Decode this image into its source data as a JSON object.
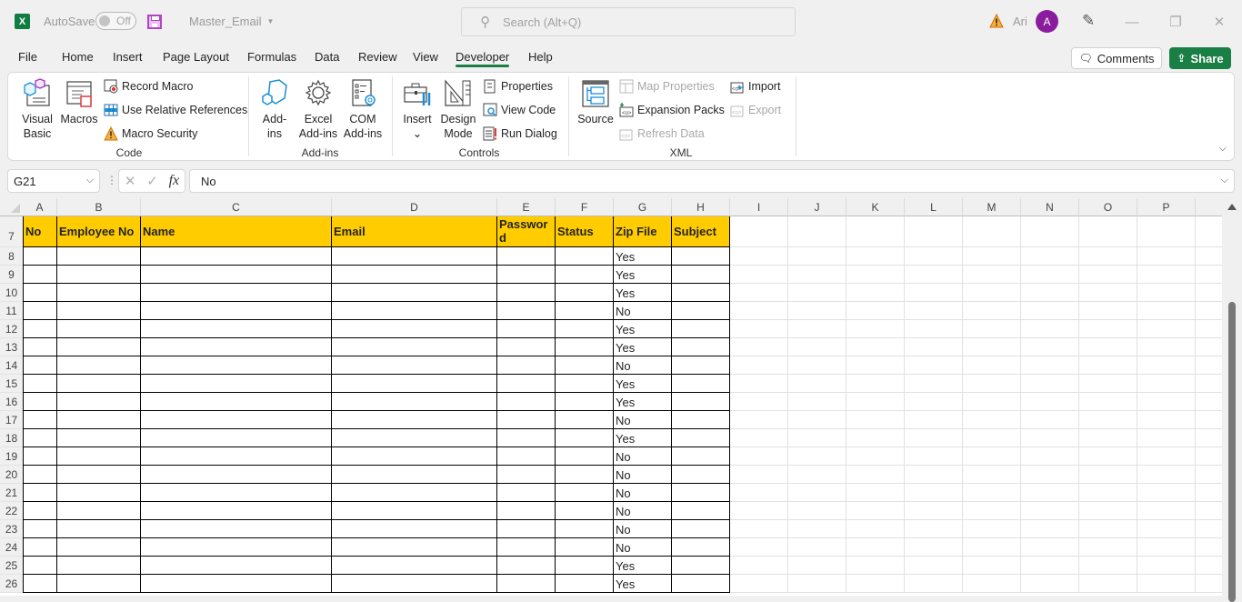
{
  "titlebar": {
    "app_icon": "excel-logo",
    "app_icon_letter": "X",
    "autosave_label": "AutoSave",
    "autosave_state": "Off",
    "save_icon": "save-icon",
    "filename": "Master_Email",
    "search_placeholder": "Search (Alt+Q)",
    "warning_icon": "warning-icon",
    "user_name": "Ari",
    "avatar_letter": "A",
    "avatar_color": "#8a1d9e",
    "pen_icon": "designer-pen-icon",
    "minimize_icon": "minimize-icon",
    "restore_icon": "restore-icon",
    "close_icon": "close-icon"
  },
  "tabs": [
    {
      "label": "File"
    },
    {
      "label": "Home"
    },
    {
      "label": "Insert"
    },
    {
      "label": "Page Layout"
    },
    {
      "label": "Formulas"
    },
    {
      "label": "Data"
    },
    {
      "label": "Review"
    },
    {
      "label": "View"
    },
    {
      "label": "Developer",
      "active": true
    },
    {
      "label": "Help"
    }
  ],
  "actions": {
    "comments_label": "Comments",
    "share_label": "Share",
    "share_color": "#1a7f45"
  },
  "ribbon": {
    "code": {
      "label": "Code",
      "visual_basic": "Visual Basic",
      "visual_basic_l1": "Visual",
      "visual_basic_l2": "Basic",
      "macros": "Macros",
      "record_macro": "Record Macro",
      "use_relative_references": "Use Relative References",
      "macro_security": "Macro Security"
    },
    "addins": {
      "label": "Add-ins",
      "addins_l1": "Add-",
      "addins_l2": "ins",
      "excel_addins_l1": "Excel",
      "excel_addins_l2": "Add-ins",
      "com_addins_l1": "COM",
      "com_addins_l2": "Add-ins"
    },
    "controls": {
      "label": "Controls",
      "insert": "Insert",
      "insert_caret": "⌄",
      "design_mode_l1": "Design",
      "design_mode_l2": "Mode",
      "properties": "Properties",
      "view_code": "View Code",
      "run_dialog": "Run Dialog"
    },
    "xml": {
      "label": "XML",
      "source": "Source",
      "map_properties": "Map Properties",
      "expansion_packs": "Expansion Packs",
      "refresh_data": "Refresh Data",
      "import": "Import",
      "export": "Export"
    },
    "collapse_icon": "chevron-down-icon"
  },
  "formula_bar": {
    "name_box": "G21",
    "cancel_glyph": "✕",
    "enter_glyph": "✓",
    "fx_label": "fx",
    "formula_value": "No"
  },
  "sheet": {
    "columns": [
      "A",
      "B",
      "C",
      "D",
      "E",
      "F",
      "G",
      "H",
      "I",
      "J",
      "K",
      "L",
      "M",
      "N",
      "O",
      "P"
    ],
    "header_row_number": "7",
    "header_fill": "#ffcc00",
    "table_headers": [
      "No",
      "Employee No",
      "Name",
      "Email",
      "Password",
      "Status",
      "Zip File",
      "Subject"
    ],
    "rows": [
      {
        "row": "8",
        "zip": "Yes"
      },
      {
        "row": "9",
        "zip": "Yes"
      },
      {
        "row": "10",
        "zip": "Yes"
      },
      {
        "row": "11",
        "zip": "No"
      },
      {
        "row": "12",
        "zip": "Yes"
      },
      {
        "row": "13",
        "zip": "Yes"
      },
      {
        "row": "14",
        "zip": "No"
      },
      {
        "row": "15",
        "zip": "Yes"
      },
      {
        "row": "16",
        "zip": "Yes"
      },
      {
        "row": "17",
        "zip": "No"
      },
      {
        "row": "18",
        "zip": "Yes"
      },
      {
        "row": "19",
        "zip": "No"
      },
      {
        "row": "20",
        "zip": "No"
      },
      {
        "row": "21",
        "zip": "No"
      },
      {
        "row": "22",
        "zip": "No"
      },
      {
        "row": "23",
        "zip": "No"
      },
      {
        "row": "24",
        "zip": "No"
      },
      {
        "row": "25",
        "zip": "Yes"
      },
      {
        "row": "26",
        "zip": "Yes"
      }
    ]
  }
}
